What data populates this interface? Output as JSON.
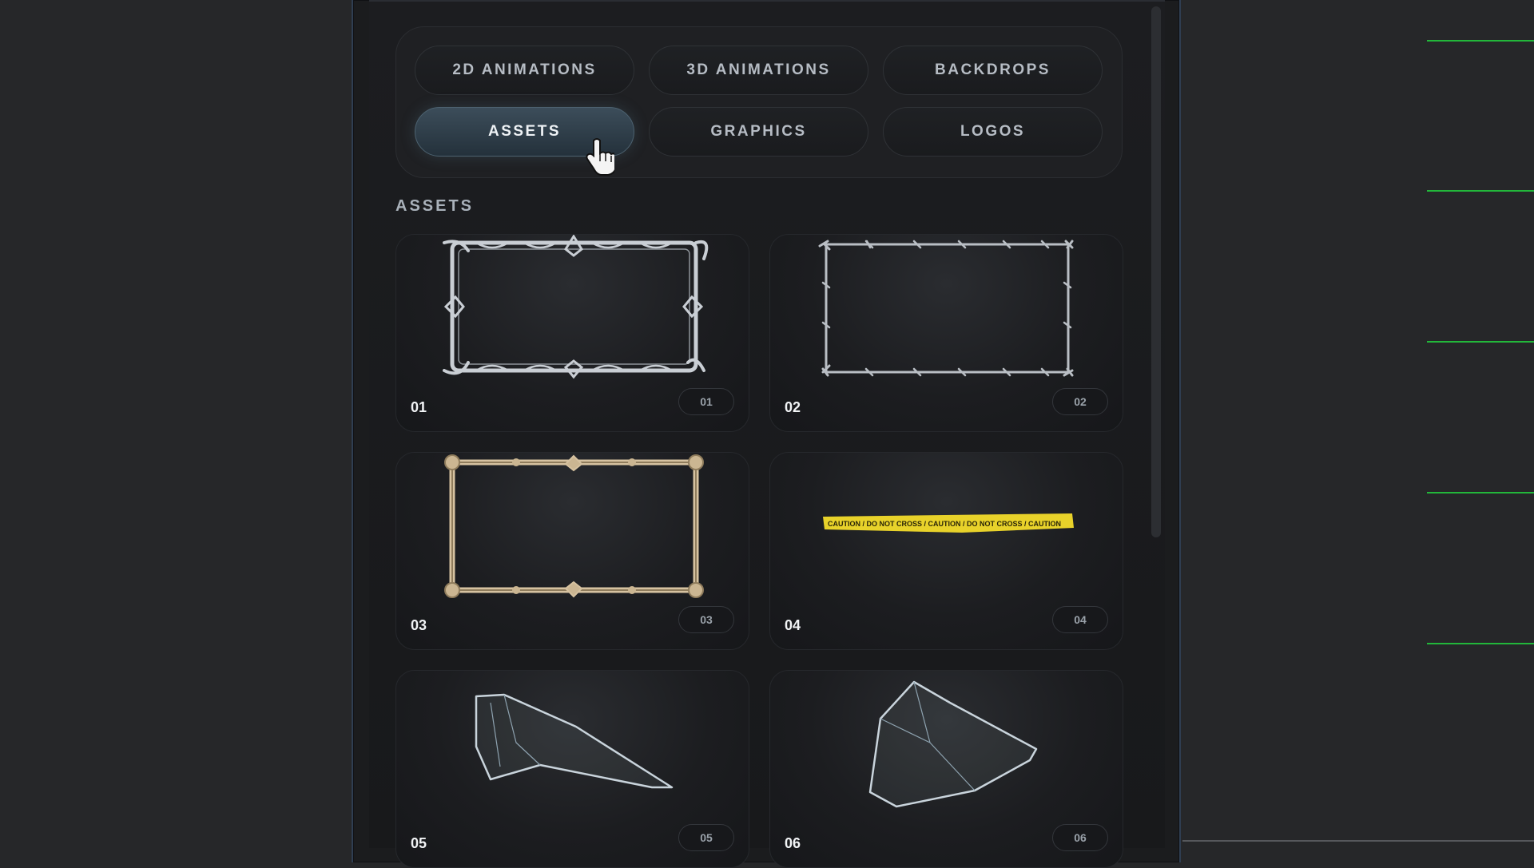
{
  "tabs": [
    {
      "label": "2D ANIMATIONS",
      "active": false
    },
    {
      "label": "3D ANIMATIONS",
      "active": false
    },
    {
      "label": "BACKDROPS",
      "active": false
    },
    {
      "label": "ASSETS",
      "active": true
    },
    {
      "label": "GRAPHICS",
      "active": false
    },
    {
      "label": "LOGOS",
      "active": false
    }
  ],
  "section_title": "ASSETS",
  "cards": [
    {
      "title": "01",
      "badge": "01",
      "art": "silver-thorn-frame-icon"
    },
    {
      "title": "02",
      "badge": "02",
      "art": "barbed-wire-frame-icon"
    },
    {
      "title": "03",
      "badge": "03",
      "art": "bone-frame-icon"
    },
    {
      "title": "04",
      "badge": "04",
      "art": "caution-tape-icon",
      "tape_text": "CAUTION / DO NOT CROSS / CAUTION / DO NOT CROSS / CAUTION"
    },
    {
      "title": "05",
      "badge": "05",
      "art": "glass-shard-icon"
    },
    {
      "title": "06",
      "badge": "06",
      "art": "glass-shard-icon"
    }
  ],
  "colors": {
    "background": "#262729",
    "panel": "#1b1c1e",
    "active_tab": "#3c4d5a",
    "accent_green": "#22b73a",
    "caution_yellow": "#e8d22a"
  }
}
